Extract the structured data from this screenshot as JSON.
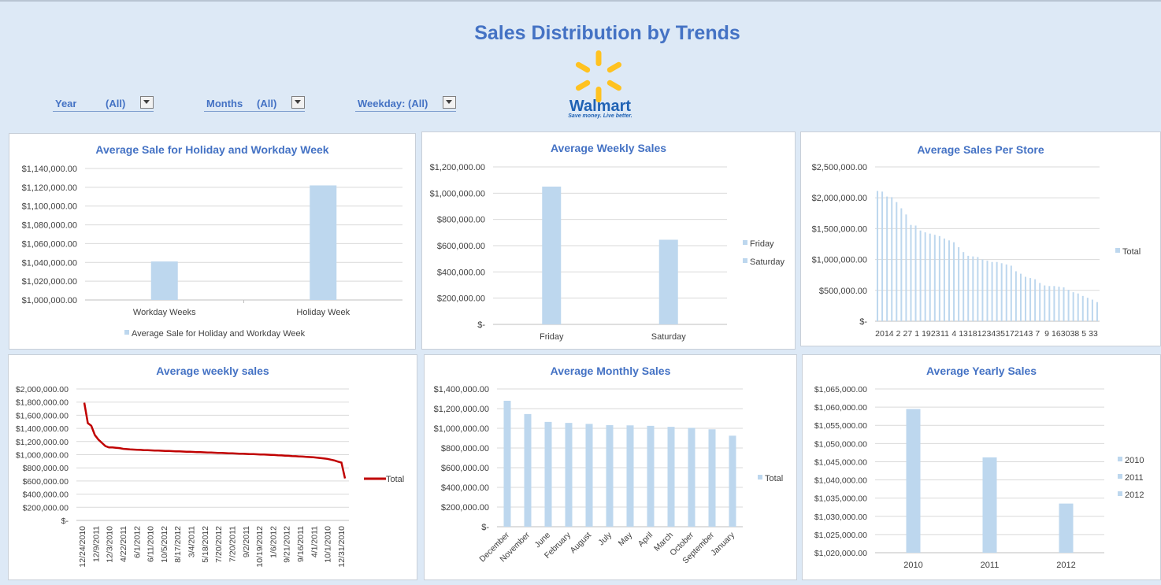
{
  "dashboard": {
    "title": "Sales Distribution by Trends",
    "colors": {
      "bar": "#bdd7ee",
      "line": "#c00000",
      "title": "#4472c4",
      "background": "#dde9f6"
    },
    "slicers": [
      {
        "label": "Year",
        "value": "(All)"
      },
      {
        "label": "Months",
        "value": "(All)"
      },
      {
        "label": "Weekday:",
        "value": "(All)"
      }
    ],
    "logo": {
      "name": "Walmart",
      "tagline": "Save money. Live better."
    }
  },
  "chart_data": [
    {
      "type": "bar",
      "title": "Average Sale for Holiday and Workday Week",
      "categories": [
        "Workday Weeks",
        "Holiday Week"
      ],
      "series": [
        {
          "name": "Average Sale for Holiday and Workday Week",
          "values": [
            1041000,
            1122000
          ]
        }
      ],
      "ylim": [
        1000000,
        1140000
      ],
      "yticks": [
        "$1,000,000.00",
        "$1,020,000.00",
        "$1,040,000.00",
        "$1,060,000.00",
        "$1,080,000.00",
        "$1,100,000.00",
        "$1,120,000.00",
        "$1,140,000.00"
      ],
      "legend": "bottom",
      "grid": true
    },
    {
      "type": "bar",
      "title": "Average Weekly Sales",
      "categories": [
        "Friday",
        "Saturday"
      ],
      "values": [
        1050000,
        645000
      ],
      "legend_entries": [
        "Friday",
        "Saturday"
      ],
      "ylim": [
        0,
        1200000
      ],
      "yticks": [
        "$-",
        "$200,000.00",
        "$400,000.00",
        "$600,000.00",
        "$800,000.00",
        "$1,000,000.00",
        "$1,200,000.00"
      ],
      "legend": "right",
      "grid": true
    },
    {
      "type": "bar",
      "title": "Average Sales Per Store",
      "xticks": [
        "20",
        "14",
        "2",
        "27",
        "1",
        "19",
        "23",
        "11",
        "4",
        "13",
        "18",
        "12",
        "34",
        "35",
        "17",
        "21",
        "43",
        "7",
        "9",
        "16",
        "30",
        "38",
        "5",
        "33"
      ],
      "series": [
        {
          "name": "Total",
          "values": [
            2110000,
            2100000,
            2020000,
            2010000,
            1930000,
            1830000,
            1730000,
            1560000,
            1550000,
            1470000,
            1440000,
            1420000,
            1400000,
            1380000,
            1340000,
            1310000,
            1280000,
            1200000,
            1120000,
            1060000,
            1050000,
            1040000,
            1000000,
            980000,
            960000,
            960000,
            940000,
            920000,
            900000,
            810000,
            770000,
            720000,
            700000,
            680000,
            620000,
            580000,
            570000,
            570000,
            560000,
            550000,
            510000,
            470000,
            450000,
            410000,
            380000,
            350000,
            310000
          ]
        }
      ],
      "ylim": [
        0,
        2500000
      ],
      "yticks": [
        "$-",
        "$500,000.00",
        "$1,000,000.00",
        "$1,500,000.00",
        "$2,000,000.00",
        "$2,500,000.00"
      ],
      "legend": "right",
      "grid": true
    },
    {
      "type": "line",
      "title": "Average weekly sales",
      "xticks": [
        "12/24/2010",
        "12/9/2011",
        "12/3/2010",
        "4/22/2011",
        "6/1/2012",
        "6/11/2010",
        "10/5/2012",
        "8/17/2012",
        "3/4/2011",
        "5/18/2012",
        "7/20/2012",
        "7/20/2011",
        "9/2/2011",
        "10/19/2012",
        "1/6/2012",
        "9/21/2012",
        "9/16/2011",
        "4/1/2011",
        "10/1/2010",
        "12/31/2010"
      ],
      "series": [
        {
          "name": "Total",
          "values": [
            1790000,
            1480000,
            1440000,
            1300000,
            1230000,
            1180000,
            1130000,
            1110000,
            1110000,
            1105000,
            1100000,
            1090000,
            1085000,
            1080000,
            1078000,
            1075000,
            1073000,
            1070000,
            1068000,
            1066000,
            1064000,
            1062000,
            1060000,
            1058000,
            1056000,
            1054000,
            1052000,
            1050000,
            1048000,
            1046000,
            1044000,
            1042000,
            1040000,
            1038000,
            1036000,
            1034000,
            1032000,
            1030000,
            1028000,
            1026000,
            1024000,
            1022000,
            1020000,
            1018000,
            1016000,
            1014000,
            1012000,
            1010000,
            1008000,
            1006000,
            1004000,
            1002000,
            1000000,
            998000,
            995000,
            992000,
            989000,
            986000,
            983000,
            980000,
            977000,
            974000,
            971000,
            968000,
            964000,
            960000,
            956000,
            950000,
            944000,
            936000,
            925000,
            912000,
            895000,
            880000,
            640000
          ]
        }
      ],
      "ylim": [
        0,
        2000000
      ],
      "yticks": [
        "$-",
        "$200,000.00",
        "$400,000.00",
        "$600,000.00",
        "$800,000.00",
        "$1,000,000.00",
        "$1,200,000.00",
        "$1,400,000.00",
        "$1,600,000.00",
        "$1,800,000.00",
        "$2,000,000.00"
      ],
      "legend": "right",
      "grid": true
    },
    {
      "type": "bar",
      "title": "Average Monthly Sales",
      "categories": [
        "December",
        "November",
        "June",
        "February",
        "August",
        "July",
        "May",
        "April",
        "March",
        "October",
        "September",
        "January"
      ],
      "series": [
        {
          "name": "Total",
          "values": [
            1280000,
            1145000,
            1065000,
            1055000,
            1045000,
            1032000,
            1030000,
            1025000,
            1015000,
            1005000,
            990000,
            925000
          ]
        }
      ],
      "ylim": [
        0,
        1400000
      ],
      "yticks": [
        "$-",
        "$200,000.00",
        "$400,000.00",
        "$600,000.00",
        "$800,000.00",
        "$1,000,000.00",
        "$1,200,000.00",
        "$1,400,000.00"
      ],
      "legend": "right",
      "grid": true
    },
    {
      "type": "bar",
      "title": "Average Yearly Sales",
      "categories": [
        "2010",
        "2011",
        "2012"
      ],
      "values": [
        1059500,
        1046200,
        1033500
      ],
      "legend_entries": [
        "2010",
        "2011",
        "2012"
      ],
      "ylim": [
        1020000,
        1065000
      ],
      "yticks": [
        "$1,020,000.00",
        "$1,025,000.00",
        "$1,030,000.00",
        "$1,035,000.00",
        "$1,040,000.00",
        "$1,045,000.00",
        "$1,050,000.00",
        "$1,055,000.00",
        "$1,060,000.00",
        "$1,065,000.00"
      ],
      "legend": "right",
      "grid": true
    }
  ]
}
